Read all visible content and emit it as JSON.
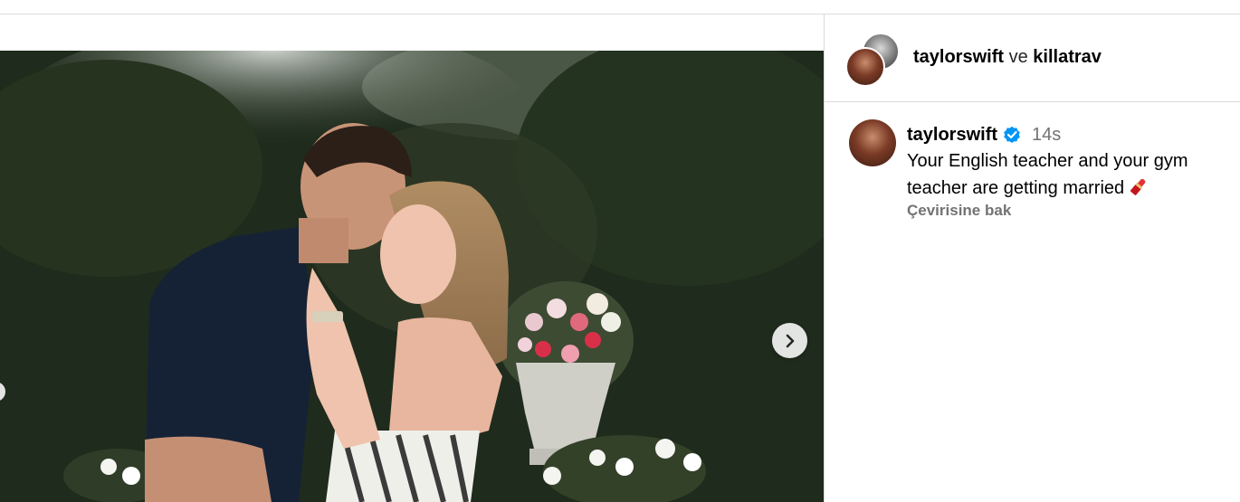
{
  "header": {
    "user1": "taylorswift",
    "conjunction": "ve",
    "user2": "killatrav"
  },
  "comment": {
    "username": "taylorswift",
    "verified_icon": "verified-badge-icon",
    "time": "14s",
    "text": "Your English teacher and your gym teacher are getting married",
    "emoji_icon": "lipstick-icon",
    "translate_label": "Çevirisine bak"
  },
  "media": {
    "next_icon": "chevron-right-icon",
    "prev_icon": "chevron-left-icon"
  },
  "colors": {
    "verified": "#0095f6",
    "secondary_text": "#737373",
    "divider": "#dbdbdb"
  }
}
